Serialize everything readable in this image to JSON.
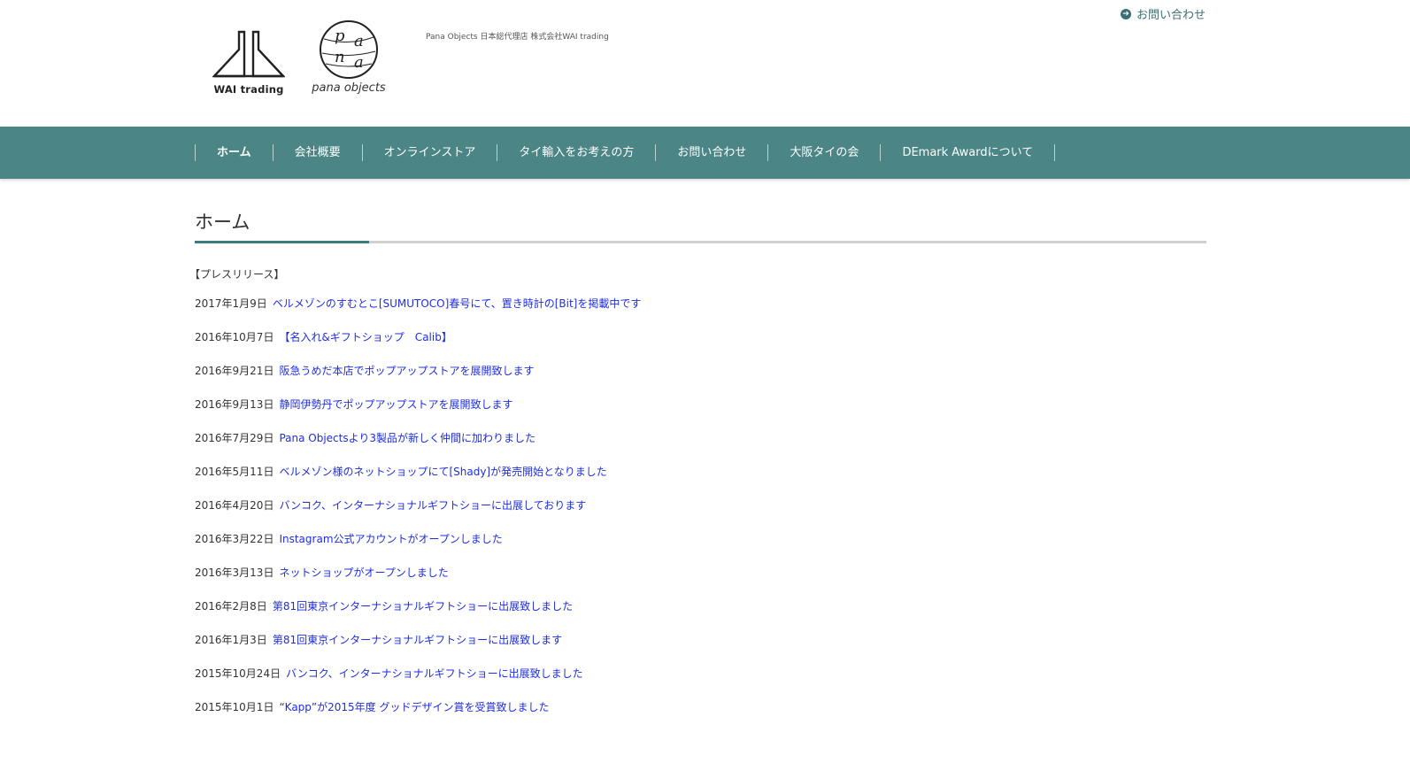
{
  "header": {
    "wai_logo_text": "WAI trading",
    "pana_logo_text": "pana objects",
    "pana_logo_letters": [
      "p",
      "a",
      "n",
      "a"
    ],
    "tagline": "Pana Objects 日本総代理店 株式会社WAI trading",
    "contact_link": "お問い合わせ"
  },
  "nav": {
    "items": [
      {
        "label": "ホーム",
        "active": true
      },
      {
        "label": "会社概要"
      },
      {
        "label": "オンラインストア"
      },
      {
        "label": "タイ輸入をお考えの方"
      },
      {
        "label": "お問い合わせ"
      },
      {
        "label": "大阪タイの会"
      },
      {
        "label": "DEmark Awardについて"
      }
    ]
  },
  "main": {
    "title": "ホーム",
    "press_heading": "【プレスリリース】",
    "news": [
      {
        "date": "2017年1月9日",
        "title": "ベルメゾンのすむとこ[SUMUTOCO]春号にて、置き時計の[Bit]を掲載中です"
      },
      {
        "date": "2016年10月7日",
        "title": "【名入れ&ギフトショップ　Calib】"
      },
      {
        "date": "2016年9月21日",
        "title": "阪急うめだ本店でポップアップストアを展開致します"
      },
      {
        "date": "2016年9月13日",
        "title": "静岡伊勢丹でポップアップストアを展開致します"
      },
      {
        "date": "2016年7月29日",
        "title": "Pana Objectsより3製品が新しく仲間に加わりました"
      },
      {
        "date": "2016年5月11日",
        "title": "ベルメゾン様のネットショップにて[Shady]が発売開始となりました"
      },
      {
        "date": "2016年4月20日",
        "title": "バンコク、インターナショナルギフトショーに出展しております"
      },
      {
        "date": "2016年3月22日",
        "title": "Instagram公式アカウントがオープンしました"
      },
      {
        "date": "2016年3月13日",
        "title": "ネットショップがオープンしました"
      },
      {
        "date": "2016年2月8日",
        "title": "第81回東京インターナショナルギフトショーに出展致しました"
      },
      {
        "date": "2016年1月3日",
        "title": "第81回東京インターナショナルギフトショーに出展致します"
      },
      {
        "date": "2015年10月24日",
        "title": "バンコク、インターナショナルギフトショーに出展致しました"
      },
      {
        "date": "2015年10月1日",
        "title": "“Kapp”が2015年度 グッドデザイン賞を受賞致しました"
      }
    ]
  }
}
